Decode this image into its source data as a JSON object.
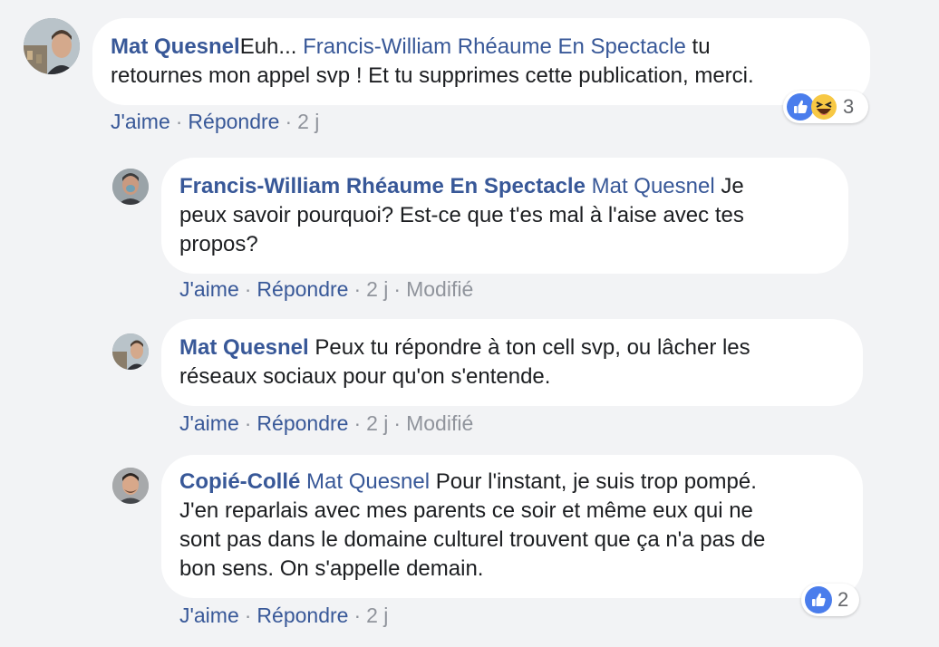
{
  "comments": [
    {
      "author": "Mat Quesnel",
      "text_pre": "Euh... ",
      "mention": "Francis-William Rhéaume En Spectacle",
      "text_post_line1": " tu",
      "line2": "retournes mon appel svp ! Et tu supprimes cette publication, merci.",
      "like_label": "J'aime",
      "reply_label": "Répondre",
      "time": "2 j",
      "reaction_count": "3",
      "reaction_icons": [
        "like-icon",
        "haha-icon"
      ]
    },
    {
      "author": "Francis-William Rhéaume En Spectacle",
      "mention": "Mat Quesnel",
      "text_line1": " Je",
      "line2": "peux savoir pourquoi? Est-ce que t'es mal à l'aise avec tes",
      "line3": "propos?",
      "like_label": "J'aime",
      "reply_label": "Répondre",
      "time": "2 j",
      "edited": "Modifié"
    },
    {
      "author": "Mat Quesnel",
      "text_line1": " Peux tu répondre à ton cell svp, ou lâcher les",
      "line2": "réseaux sociaux pour qu'on s'entende.",
      "like_label": "J'aime",
      "reply_label": "Répondre",
      "time": "2 j",
      "edited": "Modifié"
    },
    {
      "author": "Copié-Collé",
      "mention": "Mat Quesnel",
      "text_line1": " Pour l'instant, je suis trop pompé.",
      "line2": "J'en reparlais avec mes parents ce soir et même eux qui ne",
      "line3": "sont pas dans le domaine culturel trouvent que ça n'a pas de",
      "line4": "bon sens. On s'appelle demain.",
      "like_label": "J'aime",
      "reply_label": "Répondre",
      "time": "2 j",
      "reaction_count": "2",
      "reaction_icons": [
        "like-icon"
      ]
    }
  ],
  "separator": "·",
  "colors": {
    "background": "#f2f3f5",
    "bubble": "#ffffff",
    "link": "#385898",
    "meta": "#90949c",
    "like_blue": "#4a7dec",
    "haha_yellow": "#f7c844"
  }
}
